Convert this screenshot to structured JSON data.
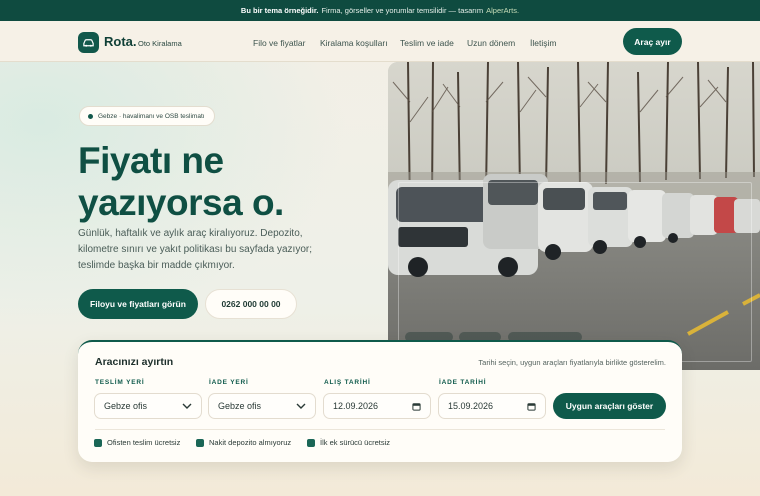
{
  "announcement": {
    "lead": "Bu bir tema örneğidir.",
    "text": "Firma, görseller ve yorumlar temsilidir — tasarım",
    "link": "AlperArts."
  },
  "brand": {
    "name": "Rota.",
    "tagline": "Oto Kiralama",
    "icon": "car-icon"
  },
  "nav": {
    "links": [
      "Filo ve fiyatlar",
      "Kiralama koşulları",
      "Teslim ve iade",
      "Uzun dönem",
      "İletişim"
    ],
    "cta": "Araç ayır"
  },
  "hero": {
    "badge": "Gebze · havalimanı ve OSB teslimatı",
    "title": "Fiyatı ne yazıyorsa o.",
    "lead": "Günlük, haftalık ve aylık araç kiralıyoruz. Depozito, kilometre sınırı ve yakıt politikası bu sayfada yazıyor; teslimde başka bir madde çıkmıyor.",
    "primary_cta": "Filoyu ve fiyatları görün",
    "phone": "0262 000 00 00"
  },
  "booking": {
    "title": "Aracınızı ayırtın",
    "hint": "Tarihi seçin, uygun araçları fiyatlarıyla birlikte gösterelim.",
    "pickup_label": "TESLİM YERİ",
    "pickup_value": "Gebze ofis",
    "return_label": "İADE YERİ",
    "return_value": "Gebze ofis",
    "pickup_date_label": "ALIŞ TARİHİ",
    "pickup_date": "12.09.2026",
    "return_date_label": "İADE TARİHİ",
    "return_date": "15.09.2026",
    "submit": "Uygun araçları göster",
    "features": [
      "Ofisten teslim ücretsiz",
      "Nakit depozito almıyoruz",
      "İlk ek sürücü ücretsiz"
    ]
  },
  "colors": {
    "brand": "#0f5a4b",
    "topbar": "#0f4b40",
    "background": "#f4efe6"
  }
}
